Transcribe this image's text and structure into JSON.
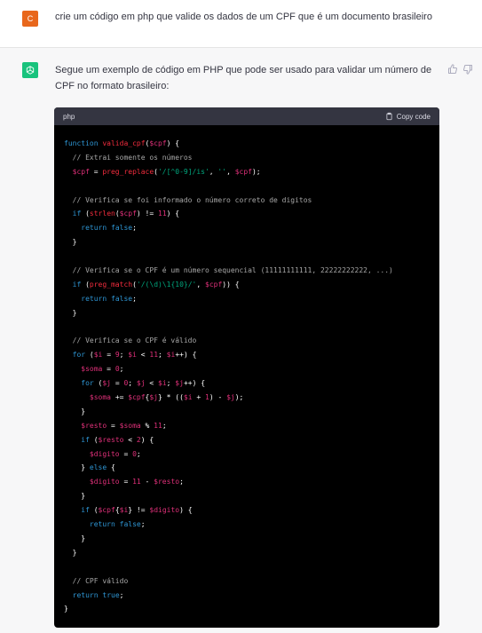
{
  "user": {
    "avatar_letter": "C",
    "avatar_color": "#e8671c",
    "message": "crie um código em php que valide os dados de um CPF que é um documento brasileiro"
  },
  "assistant": {
    "avatar_icon": "openai-logo-icon",
    "avatar_color": "#19c37d",
    "intro": "Segue um exemplo de código em PHP que pode ser usado para validar um número de CPF no formato brasileiro:",
    "feedback": {
      "thumbs_up_icon": "thumbs-up-icon",
      "thumbs_down_icon": "thumbs-down-icon"
    }
  },
  "code_block": {
    "language": "php",
    "copy_label": "Copy code",
    "lines": [
      [
        {
          "t": "kw",
          "v": "function"
        },
        {
          "t": "",
          "v": " "
        },
        {
          "t": "fn",
          "v": "valida_cpf"
        },
        {
          "t": "",
          "v": "("
        },
        {
          "t": "var",
          "v": "$cpf"
        },
        {
          "t": "",
          "v": ") {"
        }
      ],
      [
        {
          "t": "",
          "v": "  "
        },
        {
          "t": "com",
          "v": "// Extrai somente os números"
        }
      ],
      [
        {
          "t": "",
          "v": "  "
        },
        {
          "t": "var",
          "v": "$cpf"
        },
        {
          "t": "",
          "v": " = "
        },
        {
          "t": "fn",
          "v": "preg_replace"
        },
        {
          "t": "",
          "v": "("
        },
        {
          "t": "str",
          "v": "'/[^0-9]/is'"
        },
        {
          "t": "",
          "v": ", "
        },
        {
          "t": "str",
          "v": "''"
        },
        {
          "t": "",
          "v": ", "
        },
        {
          "t": "var",
          "v": "$cpf"
        },
        {
          "t": "",
          "v": ");"
        }
      ],
      [],
      [
        {
          "t": "",
          "v": "  "
        },
        {
          "t": "com",
          "v": "// Verifica se foi informado o número correto de digitos"
        }
      ],
      [
        {
          "t": "",
          "v": "  "
        },
        {
          "t": "kw",
          "v": "if"
        },
        {
          "t": "",
          "v": " ("
        },
        {
          "t": "fn",
          "v": "strlen"
        },
        {
          "t": "",
          "v": "("
        },
        {
          "t": "var",
          "v": "$cpf"
        },
        {
          "t": "",
          "v": ") != "
        },
        {
          "t": "num",
          "v": "11"
        },
        {
          "t": "",
          "v": ") {"
        }
      ],
      [
        {
          "t": "",
          "v": "    "
        },
        {
          "t": "kw",
          "v": "return"
        },
        {
          "t": "",
          "v": " "
        },
        {
          "t": "kw",
          "v": "false"
        },
        {
          "t": "",
          "v": ";"
        }
      ],
      [
        {
          "t": "",
          "v": "  }"
        }
      ],
      [],
      [
        {
          "t": "",
          "v": "  "
        },
        {
          "t": "com",
          "v": "// Verifica se o CPF é um número sequencial (11111111111, 22222222222, ...)"
        }
      ],
      [
        {
          "t": "",
          "v": "  "
        },
        {
          "t": "kw",
          "v": "if"
        },
        {
          "t": "",
          "v": " ("
        },
        {
          "t": "fn",
          "v": "preg_match"
        },
        {
          "t": "",
          "v": "("
        },
        {
          "t": "str",
          "v": "'/(\\d)\\1{10}/'"
        },
        {
          "t": "",
          "v": ", "
        },
        {
          "t": "var",
          "v": "$cpf"
        },
        {
          "t": "",
          "v": ")) {"
        }
      ],
      [
        {
          "t": "",
          "v": "    "
        },
        {
          "t": "kw",
          "v": "return"
        },
        {
          "t": "",
          "v": " "
        },
        {
          "t": "kw",
          "v": "false"
        },
        {
          "t": "",
          "v": ";"
        }
      ],
      [
        {
          "t": "",
          "v": "  }"
        }
      ],
      [],
      [
        {
          "t": "",
          "v": "  "
        },
        {
          "t": "com",
          "v": "// Verifica se o CPF é válido"
        }
      ],
      [
        {
          "t": "",
          "v": "  "
        },
        {
          "t": "kw",
          "v": "for"
        },
        {
          "t": "",
          "v": " ("
        },
        {
          "t": "var",
          "v": "$i"
        },
        {
          "t": "",
          "v": " = "
        },
        {
          "t": "num",
          "v": "9"
        },
        {
          "t": "",
          "v": "; "
        },
        {
          "t": "var",
          "v": "$i"
        },
        {
          "t": "",
          "v": " < "
        },
        {
          "t": "num",
          "v": "11"
        },
        {
          "t": "",
          "v": "; "
        },
        {
          "t": "var",
          "v": "$i"
        },
        {
          "t": "",
          "v": "++) {"
        }
      ],
      [
        {
          "t": "",
          "v": "    "
        },
        {
          "t": "var",
          "v": "$soma"
        },
        {
          "t": "",
          "v": " = "
        },
        {
          "t": "num",
          "v": "0"
        },
        {
          "t": "",
          "v": ";"
        }
      ],
      [
        {
          "t": "",
          "v": "    "
        },
        {
          "t": "kw",
          "v": "for"
        },
        {
          "t": "",
          "v": " ("
        },
        {
          "t": "var",
          "v": "$j"
        },
        {
          "t": "",
          "v": " = "
        },
        {
          "t": "num",
          "v": "0"
        },
        {
          "t": "",
          "v": "; "
        },
        {
          "t": "var",
          "v": "$j"
        },
        {
          "t": "",
          "v": " < "
        },
        {
          "t": "var",
          "v": "$i"
        },
        {
          "t": "",
          "v": "; "
        },
        {
          "t": "var",
          "v": "$j"
        },
        {
          "t": "",
          "v": "++) {"
        }
      ],
      [
        {
          "t": "",
          "v": "      "
        },
        {
          "t": "var",
          "v": "$soma"
        },
        {
          "t": "",
          "v": " += "
        },
        {
          "t": "var",
          "v": "$cpf"
        },
        {
          "t": "",
          "v": "{"
        },
        {
          "t": "var",
          "v": "$j"
        },
        {
          "t": "",
          "v": "} * (("
        },
        {
          "t": "var",
          "v": "$i"
        },
        {
          "t": "",
          "v": " + "
        },
        {
          "t": "num",
          "v": "1"
        },
        {
          "t": "",
          "v": ") - "
        },
        {
          "t": "var",
          "v": "$j"
        },
        {
          "t": "",
          "v": ");"
        }
      ],
      [
        {
          "t": "",
          "v": "    }"
        }
      ],
      [
        {
          "t": "",
          "v": "    "
        },
        {
          "t": "var",
          "v": "$resto"
        },
        {
          "t": "",
          "v": " = "
        },
        {
          "t": "var",
          "v": "$soma"
        },
        {
          "t": "",
          "v": " % "
        },
        {
          "t": "num",
          "v": "11"
        },
        {
          "t": "",
          "v": ";"
        }
      ],
      [
        {
          "t": "",
          "v": "    "
        },
        {
          "t": "kw",
          "v": "if"
        },
        {
          "t": "",
          "v": " ("
        },
        {
          "t": "var",
          "v": "$resto"
        },
        {
          "t": "",
          "v": " < "
        },
        {
          "t": "num",
          "v": "2"
        },
        {
          "t": "",
          "v": ") {"
        }
      ],
      [
        {
          "t": "",
          "v": "      "
        },
        {
          "t": "var",
          "v": "$digito"
        },
        {
          "t": "",
          "v": " = "
        },
        {
          "t": "num",
          "v": "0"
        },
        {
          "t": "",
          "v": ";"
        }
      ],
      [
        {
          "t": "",
          "v": "    } "
        },
        {
          "t": "kw",
          "v": "else"
        },
        {
          "t": "",
          "v": " {"
        }
      ],
      [
        {
          "t": "",
          "v": "      "
        },
        {
          "t": "var",
          "v": "$digito"
        },
        {
          "t": "",
          "v": " = "
        },
        {
          "t": "num",
          "v": "11"
        },
        {
          "t": "",
          "v": " - "
        },
        {
          "t": "var",
          "v": "$resto"
        },
        {
          "t": "",
          "v": ";"
        }
      ],
      [
        {
          "t": "",
          "v": "    }"
        }
      ],
      [
        {
          "t": "",
          "v": "    "
        },
        {
          "t": "kw",
          "v": "if"
        },
        {
          "t": "",
          "v": " ("
        },
        {
          "t": "var",
          "v": "$cpf"
        },
        {
          "t": "",
          "v": "{"
        },
        {
          "t": "var",
          "v": "$i"
        },
        {
          "t": "",
          "v": "} != "
        },
        {
          "t": "var",
          "v": "$digito"
        },
        {
          "t": "",
          "v": ") {"
        }
      ],
      [
        {
          "t": "",
          "v": "      "
        },
        {
          "t": "kw",
          "v": "return"
        },
        {
          "t": "",
          "v": " "
        },
        {
          "t": "kw",
          "v": "false"
        },
        {
          "t": "",
          "v": ";"
        }
      ],
      [
        {
          "t": "",
          "v": "    }"
        }
      ],
      [
        {
          "t": "",
          "v": "  }"
        }
      ],
      [],
      [
        {
          "t": "",
          "v": "  "
        },
        {
          "t": "com",
          "v": "// CPF válido"
        }
      ],
      [
        {
          "t": "",
          "v": "  "
        },
        {
          "t": "kw",
          "v": "return"
        },
        {
          "t": "",
          "v": " "
        },
        {
          "t": "kw",
          "v": "true"
        },
        {
          "t": "",
          "v": ";"
        }
      ],
      [
        {
          "t": "",
          "v": "}"
        }
      ]
    ]
  }
}
